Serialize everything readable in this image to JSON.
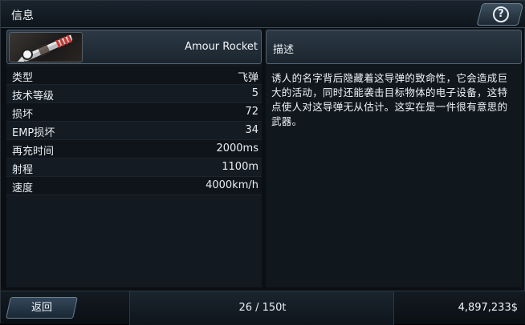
{
  "window": {
    "title": "信息"
  },
  "icons": {
    "help": "help-question-icon"
  },
  "weapon": {
    "name": "Amour Rocket",
    "thumbnail": "rocket-thumbnail"
  },
  "stats": [
    {
      "label": "类型",
      "value": "飞弹"
    },
    {
      "label": "技术等级",
      "value": "5"
    },
    {
      "label": "损坏",
      "value": "72"
    },
    {
      "label": "EMP损坏",
      "value": "34"
    },
    {
      "label": "再充时间",
      "value": "2000ms"
    },
    {
      "label": "射程",
      "value": "1100m"
    },
    {
      "label": "速度",
      "value": "4000km/h"
    }
  ],
  "description": {
    "header": "描述",
    "text": "诱人的名字背后隐藏着这导弹的致命性，它会造成巨大的活动，同时还能袭击目标物体的电子设备，这特点使人对这导弹无从估计。这实在是一件很有意思的武器。"
  },
  "footer": {
    "back_label": "返回",
    "cargo": "26 / 150t",
    "money": "4,897,233$"
  }
}
